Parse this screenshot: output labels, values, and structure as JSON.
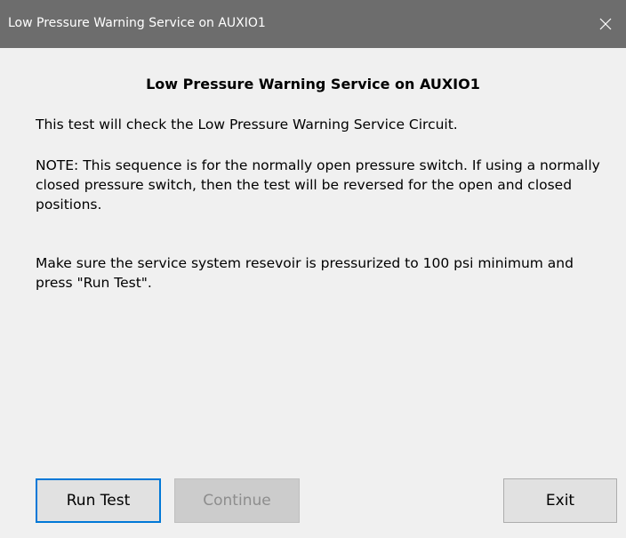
{
  "window": {
    "title": "Low Pressure Warning Service on AUXIO1",
    "close_icon": "close-icon"
  },
  "content": {
    "heading": "Low Pressure Warning Service on AUXIO1",
    "paragraphs": [
      "This test will check the Low Pressure Warning Service Circuit.",
      "NOTE: This sequence is for the normally open pressure switch.  If using a normally closed pressure switch, then the test will be reversed for the open and closed positions.",
      "Make sure the service system resevoir is pressurized to 100 psi minimum and press \"Run Test\"."
    ]
  },
  "buttons": {
    "run_test": "Run Test",
    "continue": "Continue",
    "exit": "Exit"
  },
  "colors": {
    "titlebar": "#6d6d6d",
    "background": "#f0f0f0",
    "focus_border": "#0078d7",
    "disabled_text": "#8d8d8d"
  }
}
